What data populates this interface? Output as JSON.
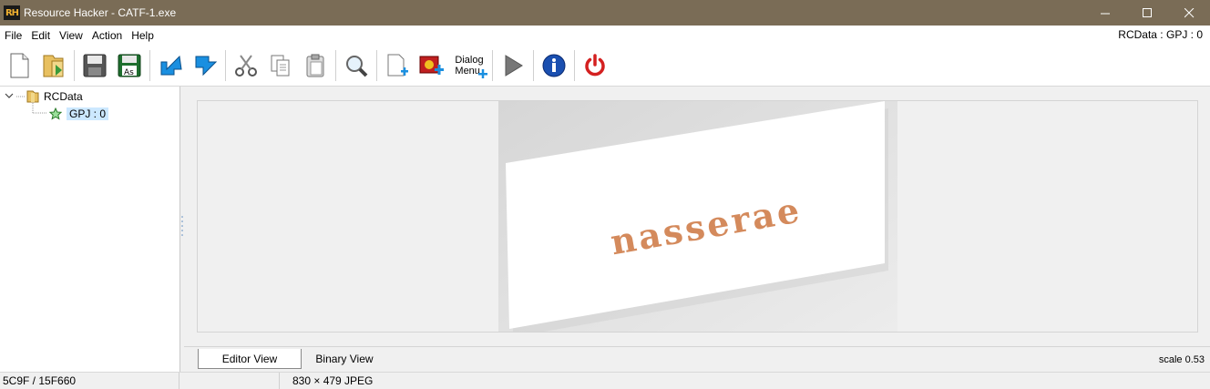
{
  "window": {
    "app_icon_text": "RH",
    "title": "Resource Hacker - CATF-1.exe",
    "minimize": "—",
    "maximize": "☐",
    "close": "✕"
  },
  "menu": {
    "items": [
      "File",
      "Edit",
      "View",
      "Action",
      "Help"
    ],
    "right_label": "RCData : GPJ : 0"
  },
  "toolbar": {
    "dialog_label_line1": "Dialog",
    "dialog_label_line2": "Menu"
  },
  "tree": {
    "root_label": "RCData",
    "child_label": "GPJ : 0"
  },
  "preview": {
    "image_text": "nasserae"
  },
  "tabs": {
    "editor_view": "Editor View",
    "binary_view": "Binary View",
    "scale": "scale 0.53"
  },
  "status": {
    "offset": "5C9F / 15F660",
    "image_info": "830 × 479  JPEG"
  },
  "colors": {
    "titlebar": "#7a6c56",
    "selection": "#cce8ff",
    "accent_blue": "#1a8fe0",
    "power_red": "#d42020"
  }
}
